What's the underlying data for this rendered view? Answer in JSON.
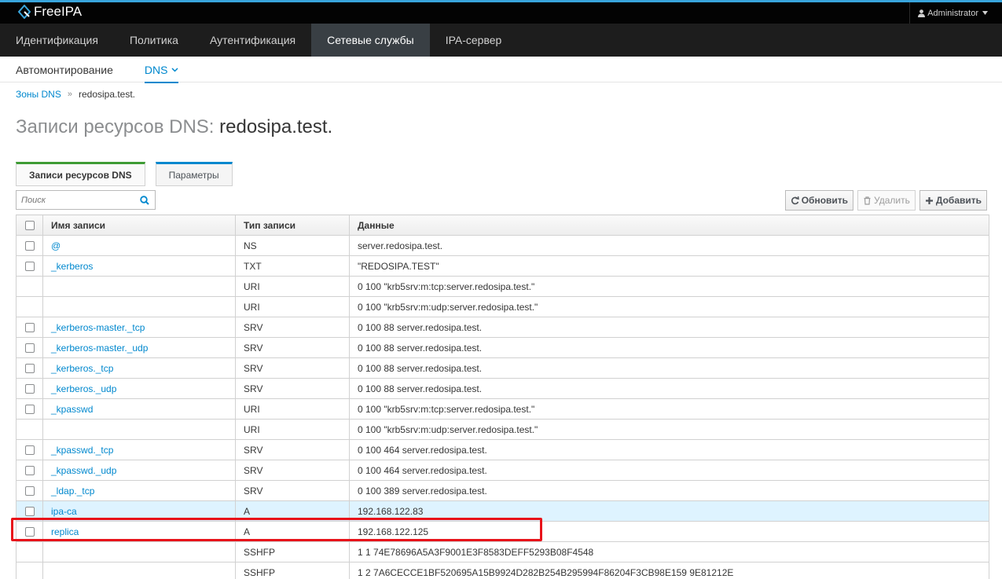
{
  "brand": {
    "name": "FreeIPA"
  },
  "user": {
    "name": "Administrator"
  },
  "main_nav": [
    {
      "label": "Идентификация",
      "active": false
    },
    {
      "label": "Политика",
      "active": false
    },
    {
      "label": "Аутентификация",
      "active": false
    },
    {
      "label": "Сетевые службы",
      "active": true
    },
    {
      "label": "IPA-сервер",
      "active": false
    }
  ],
  "sub_nav": [
    {
      "label": "Автомонтирование",
      "active": false
    },
    {
      "label": "DNS",
      "active": true
    }
  ],
  "breadcrumb": {
    "parent": "Зоны DNS",
    "separator": "»",
    "current": "redosipa.test."
  },
  "title": {
    "prefix": "Записи ресурсов DNS:",
    "name": "redosipa.test."
  },
  "tabs": [
    {
      "label": "Записи ресурсов DNS",
      "active": true
    },
    {
      "label": "Параметры",
      "active": false
    }
  ],
  "search": {
    "placeholder": "Поиск"
  },
  "toolbar": {
    "refresh": "Обновить",
    "delete": "Удалить",
    "add": "Добавить"
  },
  "table": {
    "headers": {
      "name": "Имя записи",
      "type": "Тип записи",
      "data": "Данные"
    },
    "rows": [
      {
        "name": "@",
        "type": "NS",
        "data": "server.redosipa.test.",
        "checkbox": true
      },
      {
        "name": "_kerberos",
        "type": "TXT",
        "data": "\"REDOSIPA.TEST\"",
        "checkbox": true
      },
      {
        "name": "",
        "type": "URI",
        "data": "0 100 \"krb5srv:m:tcp:server.redosipa.test.\"",
        "checkbox": false
      },
      {
        "name": "",
        "type": "URI",
        "data": "0 100 \"krb5srv:m:udp:server.redosipa.test.\"",
        "checkbox": false
      },
      {
        "name": "_kerberos-master._tcp",
        "type": "SRV",
        "data": "0 100 88 server.redosipa.test.",
        "checkbox": true
      },
      {
        "name": "_kerberos-master._udp",
        "type": "SRV",
        "data": "0 100 88 server.redosipa.test.",
        "checkbox": true
      },
      {
        "name": "_kerberos._tcp",
        "type": "SRV",
        "data": "0 100 88 server.redosipa.test.",
        "checkbox": true
      },
      {
        "name": "_kerberos._udp",
        "type": "SRV",
        "data": "0 100 88 server.redosipa.test.",
        "checkbox": true
      },
      {
        "name": "_kpasswd",
        "type": "URI",
        "data": "0 100 \"krb5srv:m:tcp:server.redosipa.test.\"",
        "checkbox": true
      },
      {
        "name": "",
        "type": "URI",
        "data": "0 100 \"krb5srv:m:udp:server.redosipa.test.\"",
        "checkbox": false
      },
      {
        "name": "_kpasswd._tcp",
        "type": "SRV",
        "data": "0 100 464 server.redosipa.test.",
        "checkbox": true
      },
      {
        "name": "_kpasswd._udp",
        "type": "SRV",
        "data": "0 100 464 server.redosipa.test.",
        "checkbox": true
      },
      {
        "name": "_ldap._tcp",
        "type": "SRV",
        "data": "0 100 389 server.redosipa.test.",
        "checkbox": true
      },
      {
        "name": "ipa-ca",
        "type": "A",
        "data": "192.168.122.83",
        "checkbox": true,
        "hover": true
      },
      {
        "name": "replica",
        "type": "A",
        "data": "192.168.122.125",
        "checkbox": true
      },
      {
        "name": "",
        "type": "SSHFP",
        "data": "1 1 74E78696A5A3F9001E3F8583DEFF5293B08F4548",
        "checkbox": false
      },
      {
        "name": "",
        "type": "SSHFP",
        "data": "1 2 7A6CECCE1BF520695A15B9924D282B254B295994F86204F3CB98E159 9E81212E",
        "checkbox": false
      }
    ]
  },
  "colors": {
    "accent": "#0088ce",
    "active_tab": "#3f9c35",
    "highlight": "#e8131a",
    "topbar": "#030303",
    "nav": "#1d1d1d"
  }
}
